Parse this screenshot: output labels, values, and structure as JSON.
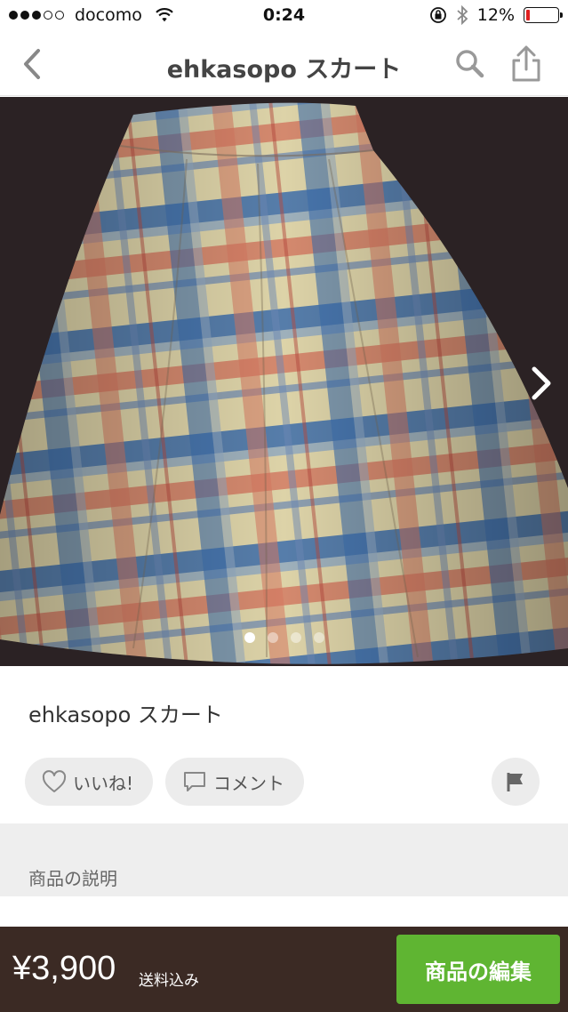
{
  "status_bar": {
    "carrier": "docomo",
    "time": "0:24",
    "battery": "12%",
    "battery_level": 0.12,
    "signal_bars": 3,
    "signal_total": 5
  },
  "nav": {
    "title": "ehkasopo スカート",
    "back_icon": "chevron-left-icon",
    "search_icon": "search-icon",
    "share_icon": "share-icon"
  },
  "gallery": {
    "page_count": 4,
    "current_page": 1,
    "next_icon": "chevron-right-icon"
  },
  "item": {
    "title": "ehkasopo スカート"
  },
  "actions": {
    "like_label": "いいね!",
    "comment_label": "コメント",
    "report_icon": "flag-icon"
  },
  "description": {
    "header": "商品の説明"
  },
  "bottom_bar": {
    "price": "¥3,900",
    "shipping": "送料込み",
    "edit_label": "商品の編集"
  },
  "colors": {
    "accent": "#5fb532",
    "bottom_bar": "#3b2a24",
    "battery_low": "#e02020"
  }
}
